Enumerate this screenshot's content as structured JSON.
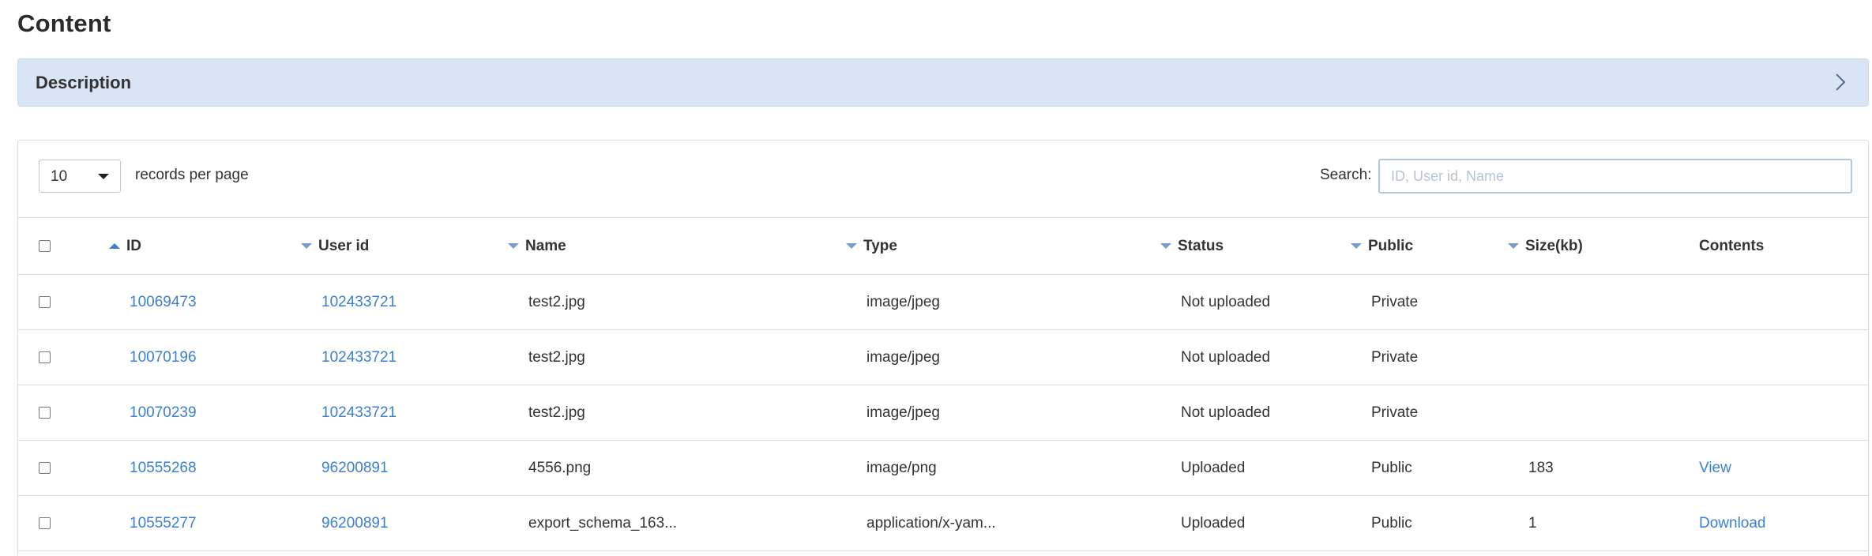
{
  "page": {
    "title": "Content"
  },
  "description": {
    "label": "Description"
  },
  "controls": {
    "page_length": "10",
    "records_label": "records per page",
    "search_label": "Search:",
    "search_placeholder": "ID, User id, Name",
    "search_value": ""
  },
  "table": {
    "headers": {
      "id": "ID",
      "user_id": "User id",
      "name": "Name",
      "type": "Type",
      "status": "Status",
      "public": "Public",
      "size": "Size(kb)",
      "contents": "Contents"
    },
    "sort": {
      "column": "ID",
      "direction": "ascending"
    },
    "rows": [
      {
        "id": "10069473",
        "user_id": "102433721",
        "name": "test2.jpg",
        "type": "image/jpeg",
        "status": "Not uploaded",
        "public": "Private",
        "size": "",
        "contents": ""
      },
      {
        "id": "10070196",
        "user_id": "102433721",
        "name": "test2.jpg",
        "type": "image/jpeg",
        "status": "Not uploaded",
        "public": "Private",
        "size": "",
        "contents": ""
      },
      {
        "id": "10070239",
        "user_id": "102433721",
        "name": "test2.jpg",
        "type": "image/jpeg",
        "status": "Not uploaded",
        "public": "Private",
        "size": "",
        "contents": ""
      },
      {
        "id": "10555268",
        "user_id": "96200891",
        "name": "4556.png",
        "type": "image/png",
        "status": "Uploaded",
        "public": "Public",
        "size": "183",
        "contents": "View"
      },
      {
        "id": "10555277",
        "user_id": "96200891",
        "name": "export_schema_163...",
        "type": "application/x-yam...",
        "status": "Uploaded",
        "public": "Public",
        "size": "1",
        "contents": "Download"
      }
    ]
  },
  "colors": {
    "link": "#3a7fd5",
    "description_bar": "#d9e5f4",
    "border": "#d4dde8"
  },
  "icons": {
    "description_toggle": "chevron-right-icon",
    "sort_asc": "sort-up-icon",
    "sort": "sort-down-icon"
  }
}
